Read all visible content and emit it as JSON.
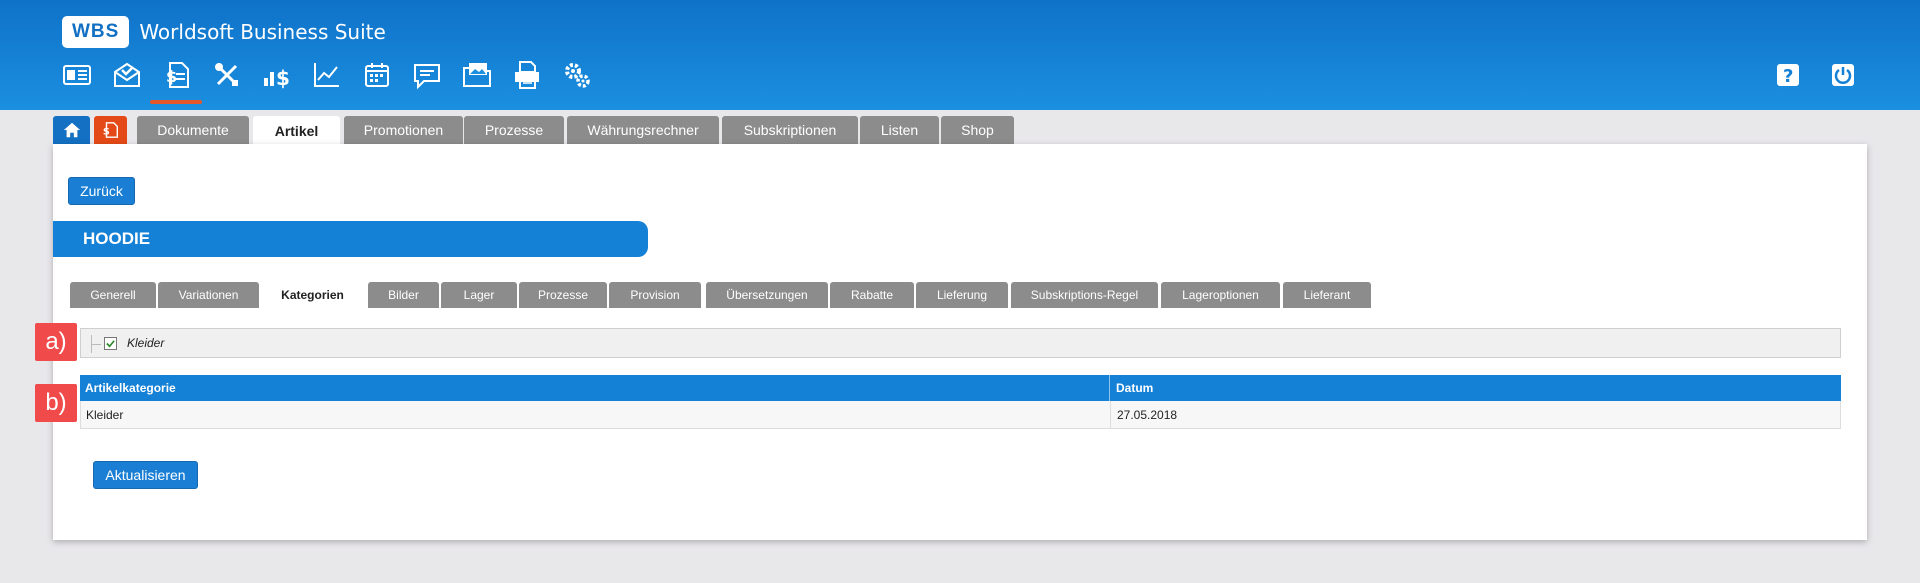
{
  "app": {
    "logo": "WBS",
    "title": "Worldsoft Business Suite"
  },
  "header_icons": [
    "contact-card-icon",
    "mail-icon",
    "document-dollar-icon",
    "tools-icon",
    "chart-dollar-icon",
    "line-chart-icon",
    "calendar-icon",
    "comment-icon",
    "image-folder-icon",
    "printer-icon",
    "settings-icon"
  ],
  "header_right_icons": [
    "help-icon",
    "power-icon"
  ],
  "main_tabs": [
    {
      "label": "Dokumente"
    },
    {
      "label": "Artikel"
    },
    {
      "label": "Promotionen"
    },
    {
      "label": "Prozesse"
    },
    {
      "label": "Währungsrechner"
    },
    {
      "label": "Subskriptionen"
    },
    {
      "label": "Listen"
    },
    {
      "label": "Shop"
    }
  ],
  "back_button": "Zurück",
  "article_title": "HOODIE",
  "sub_tabs": [
    {
      "label": "Generell"
    },
    {
      "label": "Variationen"
    },
    {
      "label": "Kategorien"
    },
    {
      "label": "Bilder"
    },
    {
      "label": "Lager"
    },
    {
      "label": "Prozesse"
    },
    {
      "label": "Provision"
    },
    {
      "label": "Übersetzungen"
    },
    {
      "label": "Rabatte"
    },
    {
      "label": "Lieferung"
    },
    {
      "label": "Subskriptions-Regel"
    },
    {
      "label": "Lageroptionen"
    },
    {
      "label": "Lieferant"
    }
  ],
  "markers": {
    "a": "a)",
    "b": "b)"
  },
  "tree": {
    "checked": true,
    "label": "Kleider"
  },
  "table": {
    "headers": [
      "Artikelkategorie",
      "Datum"
    ],
    "rows": [
      [
        "Kleider",
        "27.05.2018"
      ]
    ]
  },
  "update_button": "Aktualisieren",
  "colors": {
    "header_blue": "#1480d6",
    "accent_orange": "#e5562a",
    "marker_red": "#f04a4a",
    "tab_gray": "#8c8c8c"
  }
}
